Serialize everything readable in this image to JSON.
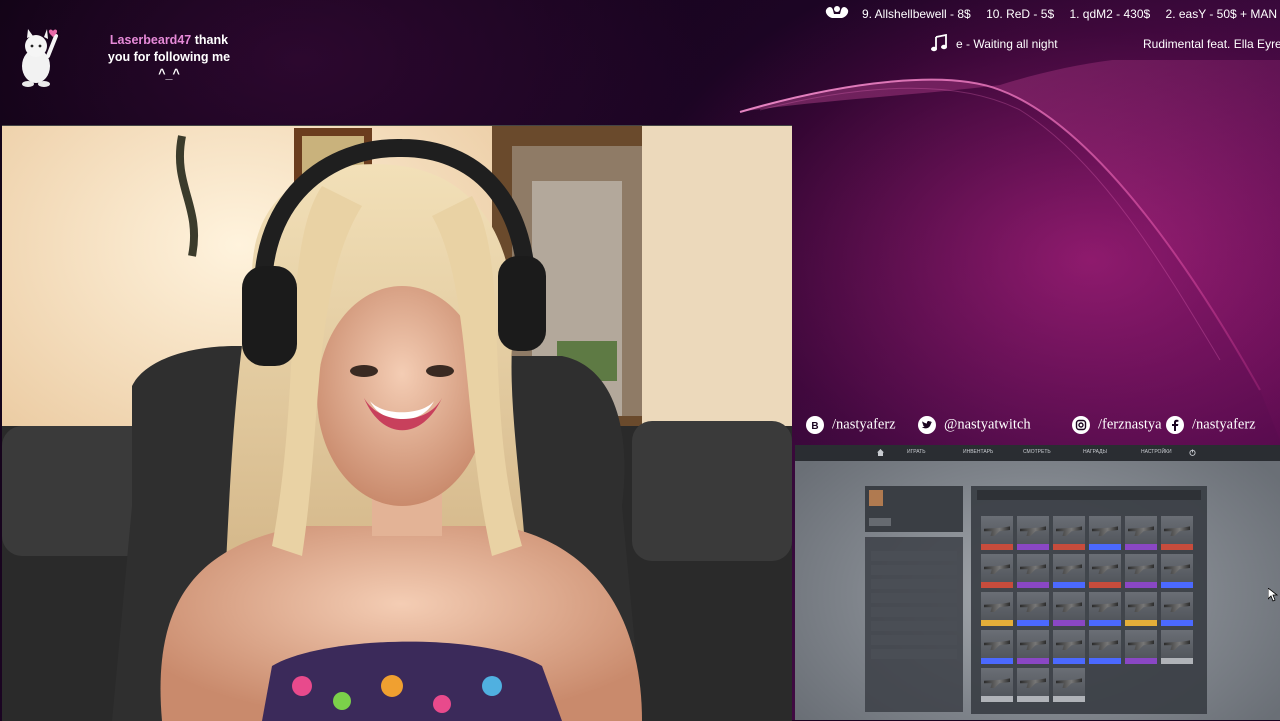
{
  "alert": {
    "username": "Laserbeard47",
    "message_1": "thank",
    "message_2": "you for following me",
    "emote": "^_^",
    "icon": "dancing-cat-icon"
  },
  "ticker": {
    "icon": "flexing-arm-icon",
    "donations": [
      "9. Allshellbewell - 8$",
      "10. ReD - 5$",
      "1. qdM2 - 430$",
      "2. easY - 50$ + MAN"
    ]
  },
  "now_playing": {
    "icon": "music-note-icon",
    "title": "e - Waiting all night",
    "artist": "Rudimental feat. Ella Eyre"
  },
  "socials": [
    {
      "icon": "vk-icon",
      "handle": "/nastyaferz"
    },
    {
      "icon": "twitter-icon",
      "handle": "@nastyatwitch"
    },
    {
      "icon": "instagram-icon",
      "handle": "/ferznastya"
    },
    {
      "icon": "facebook-icon",
      "handle": "/nastyaferz"
    }
  ],
  "game_capture": {
    "nav": [
      "ИГРАТЬ",
      "ИНВЕНТАРЬ",
      "СМОТРЕТЬ",
      "НАГРАДЫ",
      "НАСТРОЙКИ"
    ]
  },
  "colors": {
    "accent": "#e68ad8",
    "background": "#1a0420",
    "glow": "#d62896"
  }
}
